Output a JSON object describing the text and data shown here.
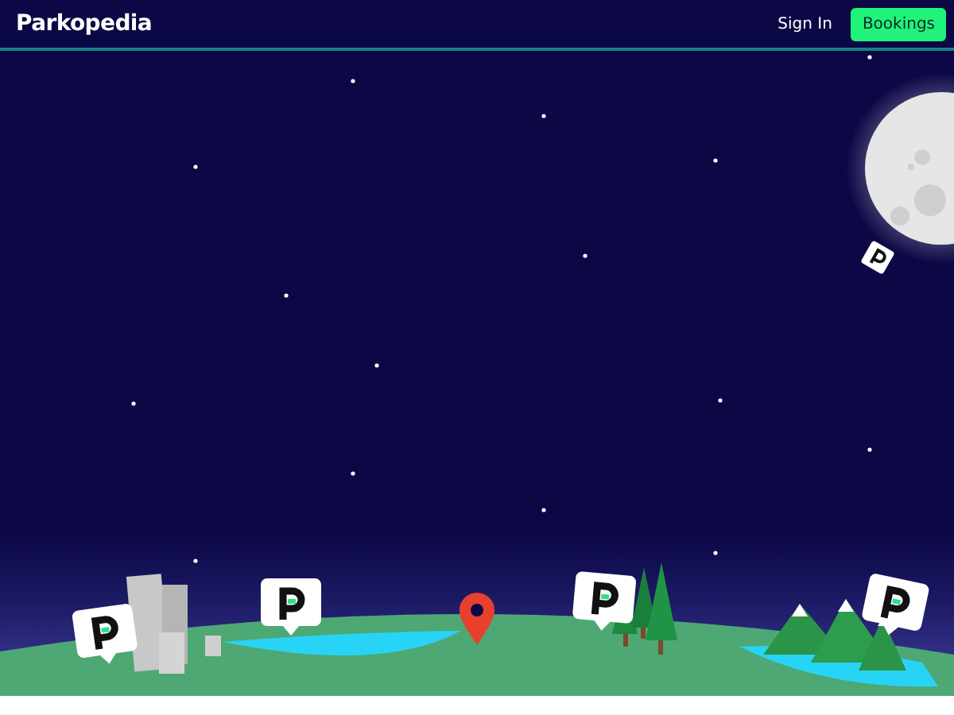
{
  "header": {
    "logo": "Parkopedia",
    "nav": [
      {
        "label": "Sign In",
        "kind": "link"
      },
      {
        "label": "Bookings",
        "kind": "button"
      }
    ]
  }
}
